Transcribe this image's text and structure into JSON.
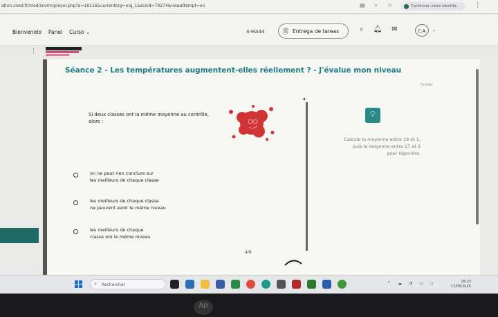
{
  "browser": {
    "url": "ation.cned.fr/mod/scorm/player.php?a=16116&currentorg=org_1&scoid=79274&newattempt=on",
    "confirm_label": "Confirmer votre identité"
  },
  "nav": {
    "links": [
      "Bienvenido",
      "Panel",
      "Curso"
    ],
    "course_code": "4-MA44",
    "entrega_label": "Entrega de tareas",
    "user_initials": "C.A."
  },
  "page": {
    "title": "Séance 2 - Les températures augmentent-elles réellement ? - J'évalue mon niveau",
    "close_label": "Fermer",
    "question_line1": "Si deux classes ont la même moyenne au contrôle,",
    "question_line2": "alors :",
    "hint_line1": "Calcule la moyenne entre 19 et 1,",
    "hint_line2": "puis la moyenne entre 17 et 3",
    "hint_line3": "pour répondre.",
    "options": [
      {
        "line1": "on ne peut rien conclure sur",
        "line2": "les meilleurs de chaque classe"
      },
      {
        "line1": "les meilleurs de chaque classe",
        "line2": "ne peuvent avoir le même niveau"
      },
      {
        "line1": "les meilleurs de chaque",
        "line2": "classe ont le même niveau"
      }
    ],
    "page_indicator": "4/9"
  },
  "taskbar": {
    "search_placeholder": "Rechercher",
    "time": "18:23",
    "date": "17/05/2025"
  },
  "colors": {
    "title": "#1d7d86",
    "accent": "#2a8a88",
    "splat": "#d03434"
  }
}
